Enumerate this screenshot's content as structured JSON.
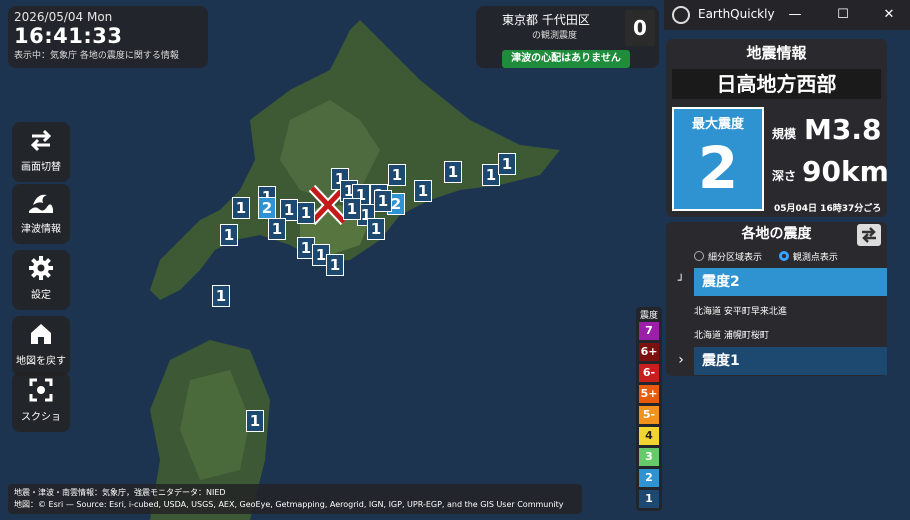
{
  "clock": {
    "date": "2026/05/04 Mon",
    "time": "16:41:33",
    "status": "表示中：気象庁 各地の震度に関する情報"
  },
  "observation": {
    "location": "東京都 千代田区",
    "label": "の観測震度",
    "value": "0",
    "tsunami": "津波の心配はありません"
  },
  "titlebar": {
    "app_name": "EarthQuickly",
    "minimize": "—",
    "maximize": "☐",
    "close": "✕"
  },
  "side_buttons": [
    {
      "label": "画面切替",
      "icon": "swap-arrows-icon"
    },
    {
      "label": "津波情報",
      "icon": "wave-icon"
    },
    {
      "label": "設定",
      "icon": "gear-icon"
    },
    {
      "label": "地図を戻す",
      "icon": "home-icon"
    },
    {
      "label": "スクショ",
      "icon": "screenshot-icon"
    }
  ],
  "eq_info": {
    "heading": "地震情報",
    "region": "日高地方西部",
    "max_intensity_label": "最大震度",
    "max_intensity": "2",
    "magnitude_label": "規模",
    "magnitude": "M3.8",
    "depth_label": "深さ",
    "depth": "90km",
    "time": "05月04日 16時37分ごろ"
  },
  "regional": {
    "heading": "各地の震度",
    "option_area": "細分区域表示",
    "option_station": "観測点表示",
    "level2": "震度2",
    "level2_points": [
      "北海道 安平町早来北進",
      "北海道 浦幌町桜町"
    ],
    "level1": "震度1",
    "collapse_icon": "┘",
    "expand_icon": "›"
  },
  "legend": {
    "title": "震度",
    "levels": [
      {
        "label": "7",
        "color": "#9b1fa8"
      },
      {
        "label": "6+",
        "color": "#7a1010"
      },
      {
        "label": "6-",
        "color": "#c81e1e"
      },
      {
        "label": "5+",
        "color": "#e85a0c"
      },
      {
        "label": "5-",
        "color": "#f0921c"
      },
      {
        "label": "4",
        "color": "#f2d530"
      },
      {
        "label": "3",
        "color": "#66c96a"
      },
      {
        "label": "2",
        "color": "#2e93d0"
      },
      {
        "label": "1",
        "color": "#1d4870"
      }
    ]
  },
  "markers": [
    "1",
    "1",
    "1",
    "2",
    "1",
    "1",
    "1",
    "1",
    "1",
    "1",
    "1",
    "1",
    "2",
    "1",
    "1",
    "1",
    "1",
    "1",
    "1",
    "1",
    "1",
    "1",
    "1",
    "1",
    "1",
    "1"
  ],
  "attribution": {
    "line1": "地震・津波・南雲情報：気象庁，強震モニタデータ：NIED",
    "line2": "地図：© Esri — Source: Esri, i-cubed, USDA, USGS, AEX, GeoEye, Getmapping, Aerogrid, IGN, IGP, UPR-EGP, and the GIS User Community"
  }
}
